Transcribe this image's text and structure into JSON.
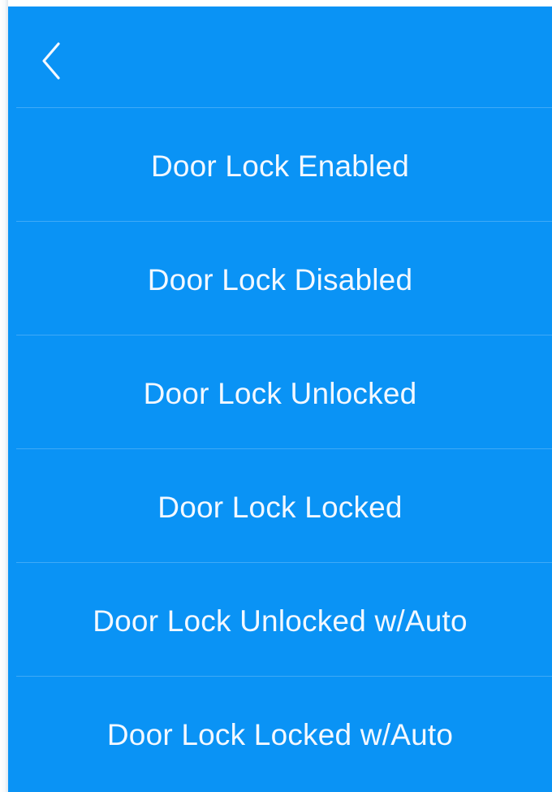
{
  "theme": {
    "background": "#0a93f5",
    "text_color": "#f2f8ff",
    "separator_color": "rgba(255,255,255,0.22)"
  },
  "header": {
    "back_icon": "chevron-left-icon"
  },
  "menu": {
    "items": [
      {
        "label": "Door Lock Enabled"
      },
      {
        "label": "Door Lock Disabled"
      },
      {
        "label": "Door Lock Unlocked"
      },
      {
        "label": "Door Lock Locked"
      },
      {
        "label": "Door Lock Unlocked w/Auto"
      },
      {
        "label": "Door Lock Locked w/Auto"
      }
    ]
  }
}
